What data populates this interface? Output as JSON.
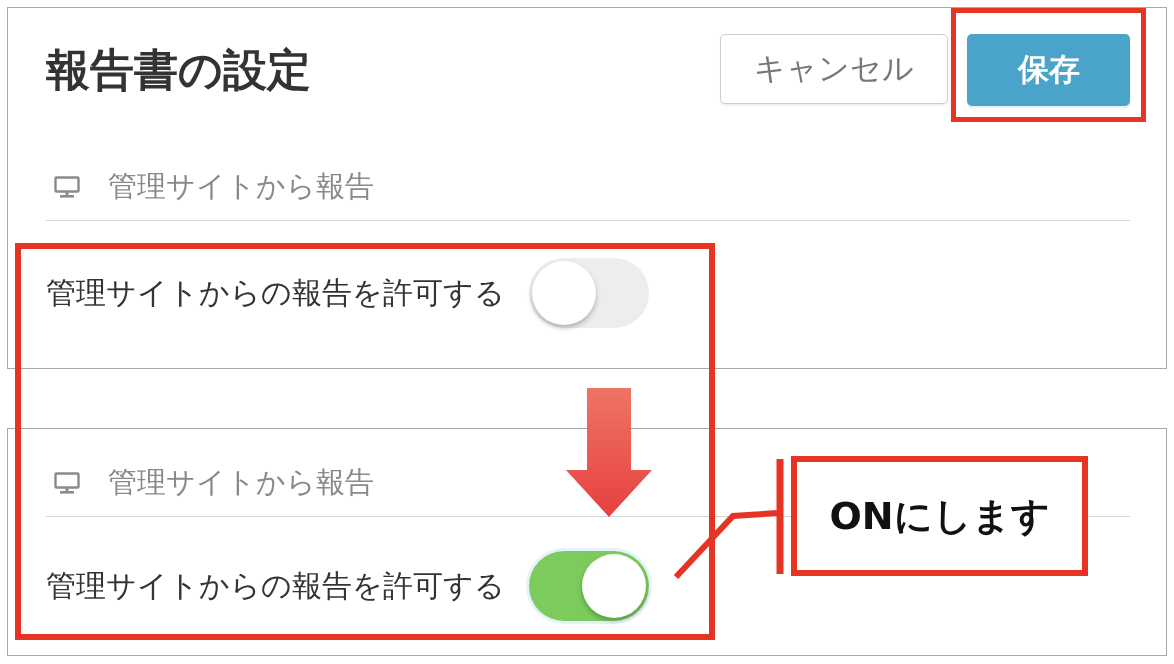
{
  "panels": [
    {
      "title": "報告書の設定",
      "buttons": [
        {
          "label": "キャンセル",
          "kind": "secondary",
          "highlighted": false
        },
        {
          "label": "保存",
          "kind": "primary",
          "highlighted": true
        }
      ],
      "section": "管理サイトから報告",
      "setting": {
        "label": "管理サイトからの報告を許可する",
        "on": false
      }
    },
    {
      "section": "管理サイトから報告",
      "setting": {
        "label": "管理サイトからの報告を許可する",
        "on": true
      }
    }
  ],
  "annotations": [
    {
      "kind": "frame"
    },
    {
      "kind": "arrow"
    },
    {
      "kind": "callout",
      "text": "ONにします"
    }
  ]
}
